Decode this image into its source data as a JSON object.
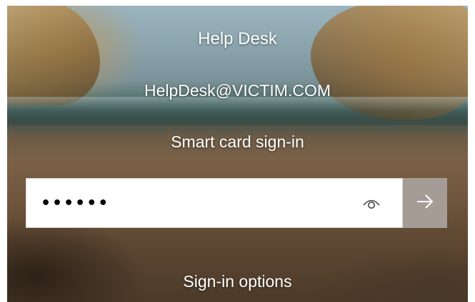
{
  "user": {
    "name": "Help Desk",
    "email": "HelpDesk@VICTIM.COM"
  },
  "signin": {
    "mode_label": "Smart card sign-in",
    "pin_value": "••••••",
    "reveal_icon": "eye-icon",
    "submit_icon": "arrow-right-icon",
    "submit_color": "#a69c96",
    "options_label": "Sign-in options"
  }
}
